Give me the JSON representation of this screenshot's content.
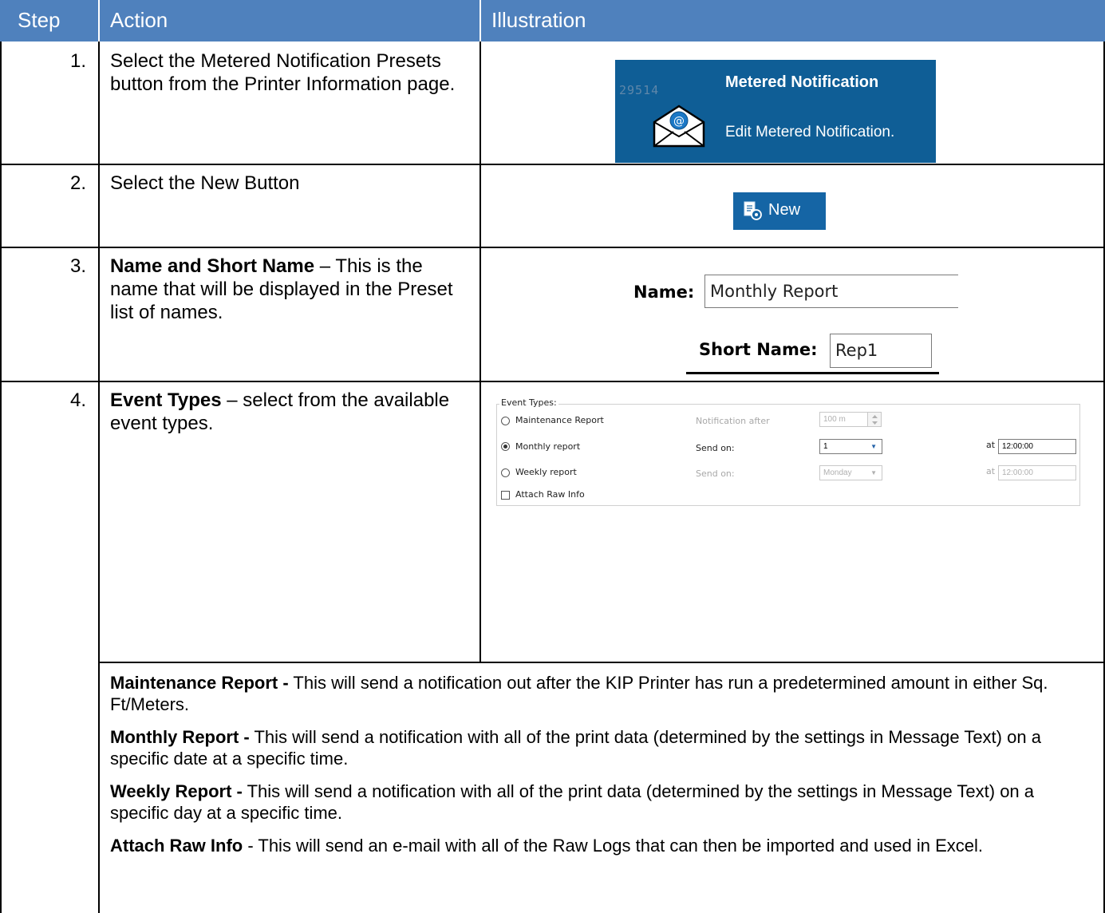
{
  "header": {
    "step": "Step",
    "action": "Action",
    "illustration": "Illustration"
  },
  "rows": [
    {
      "step": "1.",
      "action": "Select the Metered Notification Presets button from the Printer Information page."
    },
    {
      "step": "2.",
      "action": "Select the New Button"
    },
    {
      "step": "3.",
      "action_bold": "Name and Short Name",
      "action_rest": " – This is the name that will be displayed in the Preset list of names."
    },
    {
      "step": "4.",
      "action_bold": "Event Types",
      "action_rest": " – select from the available event types."
    }
  ],
  "tile": {
    "counter": "29514",
    "title": "Metered Notification",
    "subtitle": "Edit Metered Notification.",
    "icon": "envelope-at-icon"
  },
  "new_button": {
    "label": "New",
    "icon": "new-document-icon"
  },
  "name_form": {
    "name_label": "Name:",
    "name_value": "Monthly Report",
    "short_label": "Short Name:",
    "short_value": "Rep1"
  },
  "event_types": {
    "legend": "Event Types:",
    "maintenance": {
      "label": "Maintenance Report",
      "after_label": "Notification after",
      "value": "100 m"
    },
    "monthly": {
      "label": "Monthly report",
      "send_label": "Send on:",
      "value": "1",
      "at_label": "at",
      "time": "12:00:00",
      "selected": true
    },
    "weekly": {
      "label": "Weekly report",
      "send_label": "Send on:",
      "value": "Monday",
      "at_label": "at",
      "time": "12:00:00"
    },
    "attach": {
      "label": "Attach Raw Info",
      "checked": false
    }
  },
  "descriptions": [
    {
      "bold": "Maintenance Report -",
      "rest": " This will send a notification out after the KIP Printer has run a predetermined amount in either Sq. Ft/Meters."
    },
    {
      "bold": "Monthly Report -",
      "rest": " This will send a notification with all of the print data (determined by the settings in Message Text) on a specific date at a specific time."
    },
    {
      "bold": "Weekly Report -",
      "rest": " This will send a notification with all of the print data (determined by the settings in Message Text) on a specific day at a specific time."
    },
    {
      "bold": "Attach Raw Info",
      "rest": " - This will send an e-mail with all of the Raw Logs that can then be imported and used in Excel."
    }
  ],
  "colors": {
    "header_bg": "#4f81bd",
    "tile_bg": "#0f5e96",
    "button_bg": "#1565a5"
  }
}
